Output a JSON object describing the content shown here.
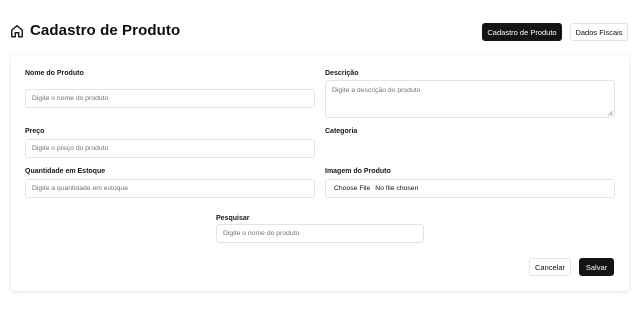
{
  "header": {
    "title": "Cadastro de Produto",
    "icon": "home-icon",
    "tabs": [
      {
        "label": "Cadastro de Produto",
        "active": true
      },
      {
        "label": "Dados Fiscais",
        "active": false
      }
    ]
  },
  "form": {
    "nome": {
      "label": "Nome do Produto",
      "placeholder": "Digite o nome do produto"
    },
    "descricao": {
      "label": "Descrição",
      "placeholder": "Digite a descrição do produto"
    },
    "preco": {
      "label": "Preço",
      "placeholder": "Digite o preço do produto"
    },
    "categoria": {
      "label": "Categoria"
    },
    "quantidade": {
      "label": "Quantidade em Estoque",
      "placeholder": "Digite a quantidade em estoque"
    },
    "imagem": {
      "label": "Imagem do Produto",
      "button_label": "Choose File",
      "status": "No file chosen"
    },
    "pesquisar": {
      "label": "Pesquisar",
      "placeholder": "Digite o nome do produto"
    }
  },
  "actions": {
    "cancel_label": "Cancelar",
    "save_label": "Salvar"
  },
  "colors": {
    "primary": "#141414",
    "border": "#e4e4e7",
    "placeholder": "#71717a"
  }
}
